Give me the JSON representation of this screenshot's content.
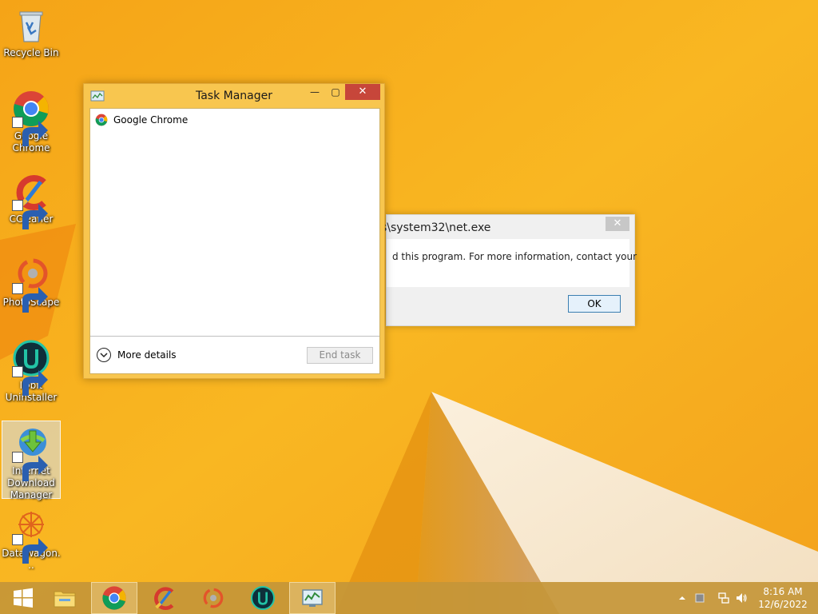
{
  "desktop": {
    "icons": [
      {
        "label": "Recycle Bin"
      },
      {
        "label": "Google Chrome"
      },
      {
        "label": "CCleaner"
      },
      {
        "label": "PhotoScape"
      },
      {
        "label": "IObit Uninstaller"
      },
      {
        "label": "Internet Download Manager"
      },
      {
        "label": "DataWagon..."
      }
    ]
  },
  "error_dialog": {
    "title": "s\\system32\\net.exe",
    "close_label": "✕",
    "message": "d this program. For more information, contact your",
    "ok_label": "OK"
  },
  "task_manager": {
    "title": "Task Manager",
    "minimize_label": "—",
    "maximize_label": "▢",
    "close_label": "✕",
    "processes": [
      {
        "name": "Google Chrome",
        "icon": "chrome-icon"
      }
    ],
    "more_details_label": "More details",
    "end_task_label": "End task"
  },
  "taskbar": {
    "items": [
      "start-icon",
      "file-explorer-icon",
      "chrome-icon",
      "ccleaner-icon",
      "photoscape-icon",
      "iobit-icon",
      "task-manager-icon"
    ],
    "active_item": "chrome-icon",
    "clock": {
      "time": "8:16 AM",
      "date": "12/6/2022"
    }
  },
  "colors": {
    "wallpaper": "#f7b21b",
    "task_manager_frame": "#f8c64f",
    "close_red": "#c7463a",
    "taskbar": "#c49638"
  }
}
